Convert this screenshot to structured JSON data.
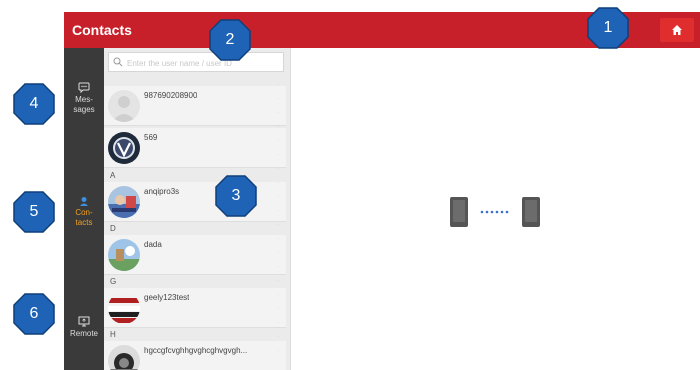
{
  "header": {
    "title": "Contacts"
  },
  "sidebar": {
    "items": [
      {
        "label_line1": "Mes-",
        "label_line2": "sages",
        "icon": "chat-bubble-icon"
      },
      {
        "label_line1": "Con-",
        "label_line2": "tacts",
        "icon": "contacts-icon"
      },
      {
        "label_line1": "Remote",
        "label_line2": "",
        "icon": "remote-icon"
      }
    ]
  },
  "search": {
    "placeholder": "Enter the user name / user ID"
  },
  "contacts": [
    {
      "group": "",
      "name": "987690208900"
    },
    {
      "group": "",
      "name": "569"
    },
    {
      "group": "A",
      "name": "anqipro3s"
    },
    {
      "group": "D",
      "name": "dada"
    },
    {
      "group": "G",
      "name": "geely123test"
    },
    {
      "group": "H",
      "name": "hgccgfcvghhgvghcghvgvgh..."
    }
  ],
  "callouts": [
    "1",
    "2",
    "3",
    "4",
    "5",
    "6"
  ],
  "colors": {
    "header_red": "#c8202a",
    "sidebar_dark": "#3a3a3a",
    "active_orange": "#f0a020",
    "callout_blue": "#1e63b6"
  }
}
